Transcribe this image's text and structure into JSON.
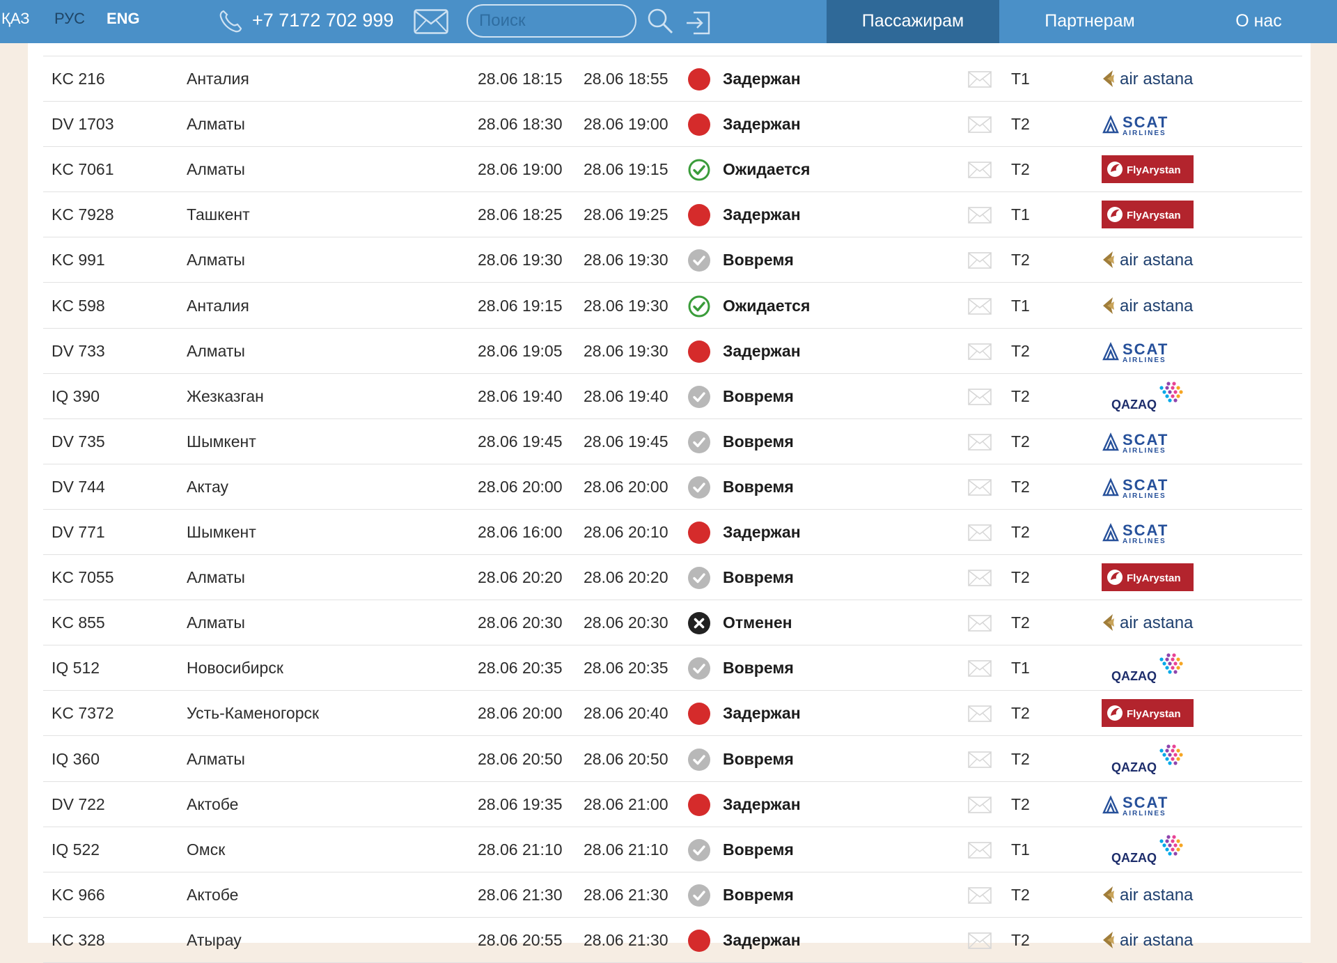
{
  "header": {
    "languages": [
      "ҚАЗ",
      "РУС",
      "ENG"
    ],
    "phone": "+7 7172 702 999",
    "search_placeholder": "Поиск",
    "nav": [
      "Пассажирам",
      "Партнерам",
      "О нас"
    ],
    "active_nav": "Пассажирам"
  },
  "colors": {
    "header_bg": "#4a90c8",
    "nav_active_bg": "#2f6998",
    "status_delayed": "#d52b2b",
    "status_expected": "#3a9c3a",
    "status_ontime": "#b8b8b8",
    "status_cancelled": "#222222",
    "airline_flyarystan": "#b3242d",
    "airline_airastana": "#1e3f6e",
    "airline_scat": "#26509a"
  },
  "flights": [
    {
      "flight": "KC 216",
      "city": "Анталия",
      "scheduled": "28.06 18:15",
      "actual": "28.06 18:55",
      "status": "Задержан",
      "status_icon": "delayed-icon",
      "terminal": "T1",
      "airline": "air astana"
    },
    {
      "flight": "DV 1703",
      "city": "Алматы",
      "scheduled": "28.06 18:30",
      "actual": "28.06 19:00",
      "status": "Задержан",
      "status_icon": "delayed-icon",
      "terminal": "T2",
      "airline": "SCAT AIRLINES"
    },
    {
      "flight": "KC 7061",
      "city": "Алматы",
      "scheduled": "28.06 19:00",
      "actual": "28.06 19:15",
      "status": "Ожидается",
      "status_icon": "expected-icon",
      "terminal": "T2",
      "airline": "FlyArystan"
    },
    {
      "flight": "KC 7928",
      "city": "Ташкент",
      "scheduled": "28.06 18:25",
      "actual": "28.06 19:25",
      "status": "Задержан",
      "status_icon": "delayed-icon",
      "terminal": "T1",
      "airline": "FlyArystan"
    },
    {
      "flight": "KC 991",
      "city": "Алматы",
      "scheduled": "28.06 19:30",
      "actual": "28.06 19:30",
      "status": "Вовремя",
      "status_icon": "ontime-icon",
      "terminal": "T2",
      "airline": "air astana"
    },
    {
      "flight": "KC 598",
      "city": "Анталия",
      "scheduled": "28.06 19:15",
      "actual": "28.06 19:30",
      "status": "Ожидается",
      "status_icon": "expected-icon",
      "terminal": "T1",
      "airline": "air astana"
    },
    {
      "flight": "DV 733",
      "city": "Алматы",
      "scheduled": "28.06 19:05",
      "actual": "28.06 19:30",
      "status": "Задержан",
      "status_icon": "delayed-icon",
      "terminal": "T2",
      "airline": "SCAT AIRLINES"
    },
    {
      "flight": "IQ 390",
      "city": "Жезказган",
      "scheduled": "28.06 19:40",
      "actual": "28.06 19:40",
      "status": "Вовремя",
      "status_icon": "ontime-icon",
      "terminal": "T2",
      "airline": "QAZAQ"
    },
    {
      "flight": "DV 735",
      "city": "Шымкент",
      "scheduled": "28.06 19:45",
      "actual": "28.06 19:45",
      "status": "Вовремя",
      "status_icon": "ontime-icon",
      "terminal": "T2",
      "airline": "SCAT AIRLINES"
    },
    {
      "flight": "DV 744",
      "city": "Актау",
      "scheduled": "28.06 20:00",
      "actual": "28.06 20:00",
      "status": "Вовремя",
      "status_icon": "ontime-icon",
      "terminal": "T2",
      "airline": "SCAT AIRLINES"
    },
    {
      "flight": "DV 771",
      "city": "Шымкент",
      "scheduled": "28.06 16:00",
      "actual": "28.06 20:10",
      "status": "Задержан",
      "status_icon": "delayed-icon",
      "terminal": "T2",
      "airline": "SCAT AIRLINES"
    },
    {
      "flight": "KC 7055",
      "city": "Алматы",
      "scheduled": "28.06 20:20",
      "actual": "28.06 20:20",
      "status": "Вовремя",
      "status_icon": "ontime-icon",
      "terminal": "T2",
      "airline": "FlyArystan"
    },
    {
      "flight": "KC 855",
      "city": "Алматы",
      "scheduled": "28.06 20:30",
      "actual": "28.06 20:30",
      "status": "Отменен",
      "status_icon": "cancelled-icon",
      "terminal": "T2",
      "airline": "air astana"
    },
    {
      "flight": "IQ 512",
      "city": "Новосибирск",
      "scheduled": "28.06 20:35",
      "actual": "28.06 20:35",
      "status": "Вовремя",
      "status_icon": "ontime-icon",
      "terminal": "T1",
      "airline": "QAZAQ"
    },
    {
      "flight": "KC 7372",
      "city": "Усть-Каменогорск",
      "scheduled": "28.06 20:00",
      "actual": "28.06 20:40",
      "status": "Задержан",
      "status_icon": "delayed-icon",
      "terminal": "T2",
      "airline": "FlyArystan"
    },
    {
      "flight": "IQ 360",
      "city": "Алматы",
      "scheduled": "28.06 20:50",
      "actual": "28.06 20:50",
      "status": "Вовремя",
      "status_icon": "ontime-icon",
      "terminal": "T2",
      "airline": "QAZAQ"
    },
    {
      "flight": "DV 722",
      "city": "Актобе",
      "scheduled": "28.06 19:35",
      "actual": "28.06 21:00",
      "status": "Задержан",
      "status_icon": "delayed-icon",
      "terminal": "T2",
      "airline": "SCAT AIRLINES"
    },
    {
      "flight": "IQ 522",
      "city": "Омск",
      "scheduled": "28.06 21:10",
      "actual": "28.06 21:10",
      "status": "Вовремя",
      "status_icon": "ontime-icon",
      "terminal": "T1",
      "airline": "QAZAQ"
    },
    {
      "flight": "KC 966",
      "city": "Актобе",
      "scheduled": "28.06 21:30",
      "actual": "28.06 21:30",
      "status": "Вовремя",
      "status_icon": "ontime-icon",
      "terminal": "T2",
      "airline": "air astana"
    },
    {
      "flight": "KC 328",
      "city": "Атырау",
      "scheduled": "28.06 20:55",
      "actual": "28.06 21:30",
      "status": "Задержан",
      "status_icon": "delayed-icon",
      "terminal": "T2",
      "airline": "air astana"
    }
  ]
}
